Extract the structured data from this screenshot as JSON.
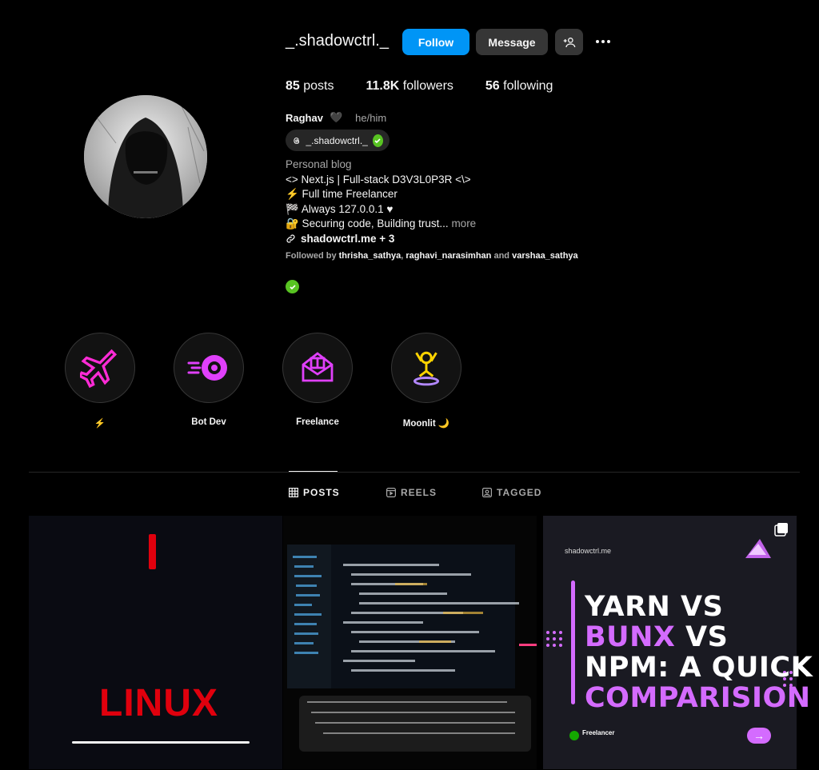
{
  "header": {
    "username": "_.shadowctrl._",
    "follow_label": "Follow",
    "message_label": "Message"
  },
  "stats": {
    "posts_count": "85",
    "posts_label": "posts",
    "followers_count": "11.8K",
    "followers_label": "followers",
    "following_count": "56",
    "following_label": "following"
  },
  "profile": {
    "name": "Raghav",
    "heart": "🖤",
    "pronouns": "he/him",
    "threads_handle": "_.shadowctrl._",
    "category": "Personal blog",
    "bio_lines": [
      "<> Next.js | Full-stack D3V3L0P3R <\\>",
      "⚡ Full time Freelancer",
      "🏁 Always 127.0.0.1 ♥",
      "🔐 Securing code, Building trust..."
    ],
    "more_label": "more",
    "link_text": "shadowctrl.me + 3",
    "followed_by_prefix": "Followed by",
    "followed_by_1": "thrisha_sathya",
    "followed_by_sep": ",",
    "followed_by_2": "raghavi_narasimhan",
    "followed_by_and": "and",
    "followed_by_3": "varshaa_sathya"
  },
  "highlights": [
    {
      "label": "⚡",
      "icon": "airplane-icon",
      "color": "#ff2bd6"
    },
    {
      "label": "Bot Dev",
      "icon": "speed-target-icon",
      "color": "#e040fb"
    },
    {
      "label": "Freelance",
      "icon": "gift-envelope-icon",
      "color": "#e040fb"
    },
    {
      "label": "Moonlit 🌙",
      "icon": "dj-icon",
      "color": "#ffd400"
    }
  ],
  "tabs": [
    {
      "label": "POSTS",
      "icon": "grid-icon",
      "active": true
    },
    {
      "label": "REELS",
      "icon": "reels-icon",
      "active": false
    },
    {
      "label": "TAGGED",
      "icon": "tagged-icon",
      "active": false
    }
  ],
  "posts": {
    "p1": {
      "title": "LINUX"
    },
    "p3": {
      "site": "shadowctrl.me",
      "t1a": "YARN VS ",
      "t1b": "BUNX",
      "t1c": " VS",
      "t2": "NPM: A QUICK",
      "t3": "COMPARISION",
      "footer": "Freelancer"
    }
  },
  "colors": {
    "accent": "#0095f6",
    "verified": "#58c322",
    "linux_red": "#e0000d",
    "purple": "#d46bff"
  }
}
